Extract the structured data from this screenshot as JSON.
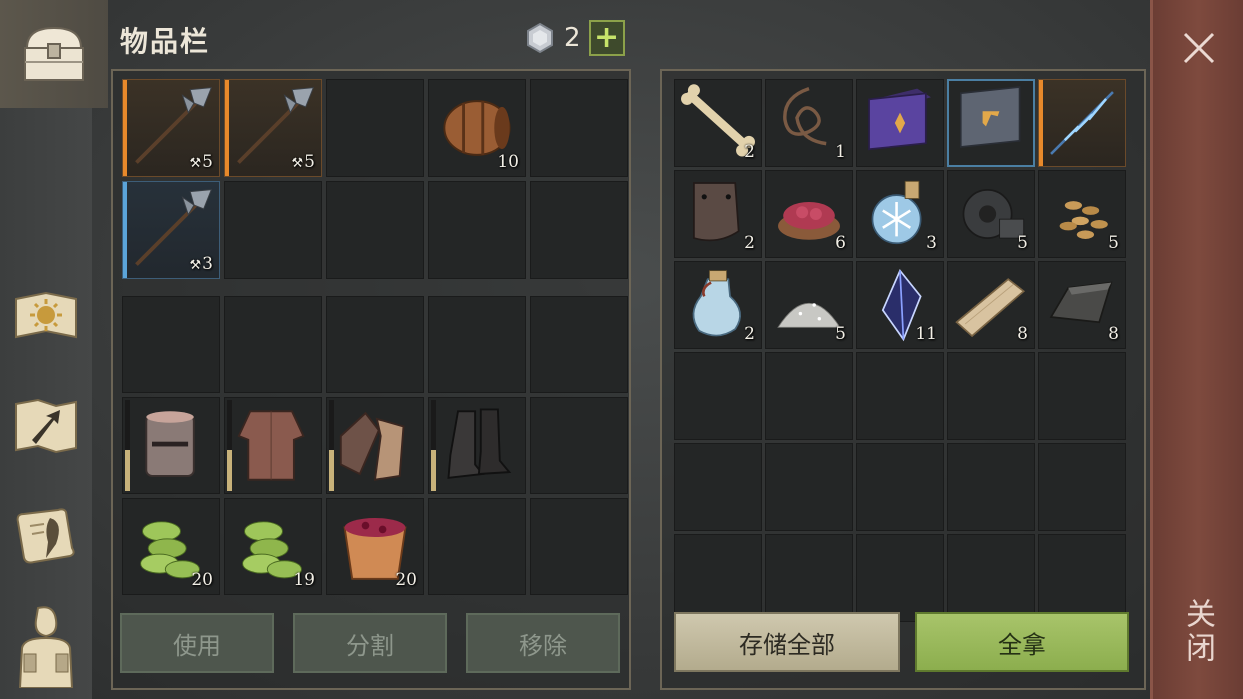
{
  "header": {
    "title": "物品栏",
    "currency_icon": "silver-coin-icon",
    "currency_count": "2",
    "add_label": "+"
  },
  "sidebar": {
    "tabs": [
      "chest-icon",
      "sun-book-icon",
      "map-arrow-icon",
      "scroll-quill-icon",
      "character-icon"
    ]
  },
  "inventory": {
    "weapons": [
      {
        "icon": "halberd-icon",
        "qty": "5",
        "rarity": "orange",
        "pickaxe": true
      },
      {
        "icon": "halberd-icon",
        "qty": "5",
        "rarity": "orange",
        "pickaxe": true
      },
      {
        "icon": "",
        "qty": ""
      },
      {
        "icon": "barrel-icon",
        "qty": "10"
      },
      {
        "icon": "",
        "qty": ""
      },
      {
        "icon": "halberd-icon",
        "qty": "3",
        "rarity": "blue",
        "pickaxe": true
      },
      {
        "icon": "",
        "qty": ""
      },
      {
        "icon": "",
        "qty": ""
      },
      {
        "icon": "",
        "qty": ""
      },
      {
        "icon": "",
        "qty": ""
      }
    ],
    "bag": [
      {
        "icon": "",
        "qty": ""
      },
      {
        "icon": "",
        "qty": ""
      },
      {
        "icon": "",
        "qty": ""
      },
      {
        "icon": "",
        "qty": ""
      },
      {
        "icon": "",
        "qty": ""
      },
      {
        "icon": "knight-helmet-icon",
        "qty": "",
        "durability": 0.45
      },
      {
        "icon": "chainmail-shirt-icon",
        "qty": "",
        "durability": 0.45
      },
      {
        "icon": "chainmail-gloves-icon",
        "qty": "",
        "durability": 0.45
      },
      {
        "icon": "iron-boots-icon",
        "qty": "",
        "durability": 0.45
      },
      {
        "icon": "",
        "qty": ""
      },
      {
        "icon": "green-coins-icon",
        "qty": "20"
      },
      {
        "icon": "green-coins-icon",
        "qty": "19"
      },
      {
        "icon": "berry-bucket-icon",
        "qty": "20"
      },
      {
        "icon": "",
        "qty": ""
      },
      {
        "icon": "",
        "qty": ""
      }
    ]
  },
  "storage": {
    "items": [
      {
        "icon": "bone-icon",
        "qty": "2"
      },
      {
        "icon": "rope-icon",
        "qty": "1"
      },
      {
        "icon": "purple-book-icon",
        "qty": ""
      },
      {
        "icon": "grey-book-icon",
        "qty": "",
        "highlight": true
      },
      {
        "icon": "lightning-spear-icon",
        "qty": "",
        "rarity": "orange"
      },
      {
        "icon": "leather-pad-icon",
        "qty": "2"
      },
      {
        "icon": "raw-meat-icon",
        "qty": "6"
      },
      {
        "icon": "frost-potion-icon",
        "qty": "3"
      },
      {
        "icon": "gear-icon",
        "qty": "5"
      },
      {
        "icon": "seeds-icon",
        "qty": "5"
      },
      {
        "icon": "water-flask-icon",
        "qty": "2"
      },
      {
        "icon": "salt-pile-icon",
        "qty": "5"
      },
      {
        "icon": "crystal-shard-icon",
        "qty": "11"
      },
      {
        "icon": "wood-plank-icon",
        "qty": "8"
      },
      {
        "icon": "iron-ingot-icon",
        "qty": "8"
      },
      {
        "icon": "",
        "qty": ""
      },
      {
        "icon": "",
        "qty": ""
      },
      {
        "icon": "",
        "qty": ""
      },
      {
        "icon": "",
        "qty": ""
      },
      {
        "icon": "",
        "qty": ""
      },
      {
        "icon": "",
        "qty": ""
      },
      {
        "icon": "",
        "qty": ""
      },
      {
        "icon": "",
        "qty": ""
      },
      {
        "icon": "",
        "qty": ""
      },
      {
        "icon": "",
        "qty": ""
      },
      {
        "icon": "",
        "qty": ""
      },
      {
        "icon": "",
        "qty": ""
      },
      {
        "icon": "",
        "qty": ""
      },
      {
        "icon": "",
        "qty": ""
      },
      {
        "icon": "",
        "qty": ""
      }
    ]
  },
  "buttons": {
    "use": "使用",
    "split": "分割",
    "remove": "移除",
    "store_all": "存储全部",
    "take_all": "全拿"
  },
  "close": {
    "icon": "close-icon",
    "label": "关闭"
  },
  "colors": {
    "orange_rarity": "#e7892b",
    "blue_rarity": "#5ba4d9",
    "take_green": "#9bbb5c",
    "close_red": "#7e4a3e"
  }
}
